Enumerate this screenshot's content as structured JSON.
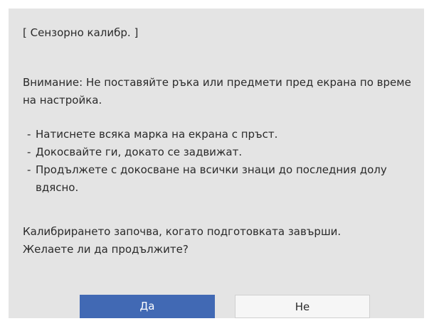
{
  "dialog": {
    "title": "[ Сензорно калибр. ]",
    "warning": "Внимание: Не поставяйте ръка или предмети пред екрана по време на настройка.",
    "steps": [
      "Натиснете всяка марка на екрана с пръст.",
      "Докосвайте ги, докато се задвижат.",
      "Продължете с докосване на всички знаци до последния долу вдясно."
    ],
    "confirm_line1": "Калибрирането започва, когато подготовката завърши.",
    "confirm_line2": "Желаете ли да продължите?",
    "buttons": {
      "yes_label": "Да",
      "no_label": "Не"
    }
  },
  "colors": {
    "dialog_background": "#e4e4e4",
    "primary_button": "#4169b4",
    "secondary_button": "#f6f6f6",
    "text": "#2a2a2a"
  }
}
